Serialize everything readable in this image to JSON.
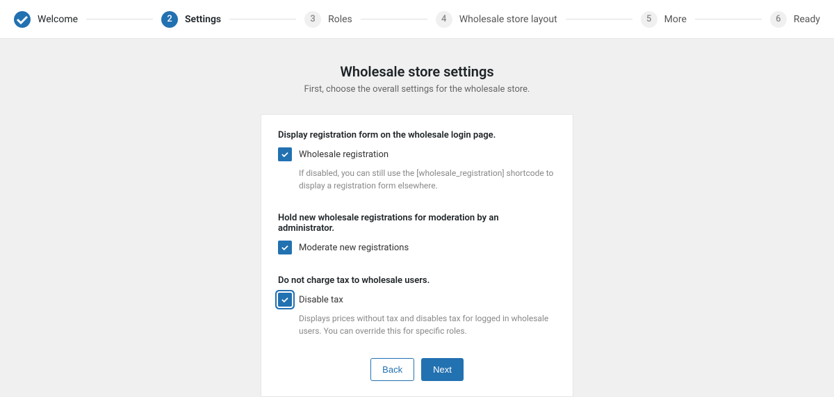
{
  "stepper": {
    "steps": [
      {
        "num": "",
        "label": "Welcome",
        "state": "completed"
      },
      {
        "num": "2",
        "label": "Settings",
        "state": "active"
      },
      {
        "num": "3",
        "label": "Roles",
        "state": "upcoming"
      },
      {
        "num": "4",
        "label": "Wholesale store layout",
        "state": "upcoming"
      },
      {
        "num": "5",
        "label": "More",
        "state": "upcoming"
      },
      {
        "num": "6",
        "label": "Ready",
        "state": "upcoming"
      }
    ]
  },
  "page": {
    "title": "Wholesale store settings",
    "subtitle": "First, choose the overall settings for the wholesale store."
  },
  "settings": {
    "registration": {
      "heading": "Display registration form on the wholesale login page.",
      "checkbox_label": "Wholesale registration",
      "help": "If disabled, you can still use the [wholesale_registration] shortcode to display a registration form elsewhere."
    },
    "moderation": {
      "heading": "Hold new wholesale registrations for moderation by an administrator.",
      "checkbox_label": "Moderate new registrations"
    },
    "tax": {
      "heading": "Do not charge tax to wholesale users.",
      "checkbox_label": "Disable tax",
      "help": "Displays prices without tax and disables tax for logged in wholesale users. You can override this for specific roles."
    }
  },
  "actions": {
    "back": "Back",
    "next": "Next"
  }
}
